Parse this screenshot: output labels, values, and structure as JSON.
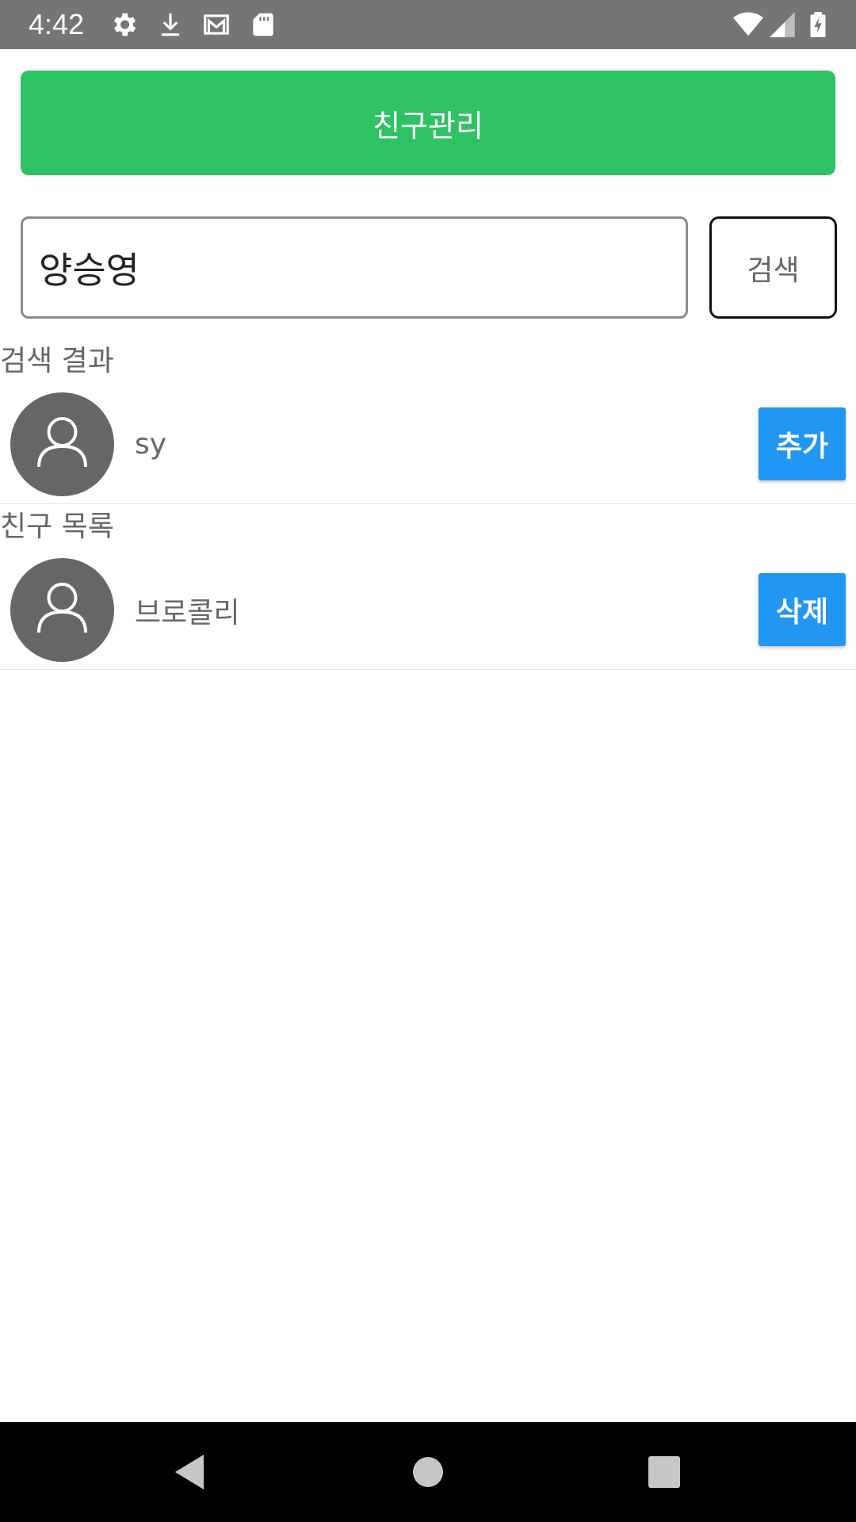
{
  "status_bar": {
    "time": "4:42",
    "icons_left": [
      "settings-icon",
      "download-icon",
      "gmail-icon",
      "sd-card-icon"
    ],
    "icons_right": [
      "wifi-icon",
      "signal-icon",
      "battery-charging-icon"
    ]
  },
  "header": {
    "title": "친구관리",
    "color": "#2ec264"
  },
  "search": {
    "value": "양승영",
    "button_label": "검색"
  },
  "search_results": {
    "title": "검색 결과",
    "items": [
      {
        "name": "sy",
        "action_label": "추가"
      }
    ]
  },
  "friends": {
    "title": "친구 목록",
    "items": [
      {
        "name": "브로콜리",
        "action_label": "삭제"
      }
    ]
  },
  "accent_color": "#2196f3",
  "nav_bar": {
    "buttons": [
      "back-icon",
      "home-icon",
      "recents-icon"
    ]
  }
}
